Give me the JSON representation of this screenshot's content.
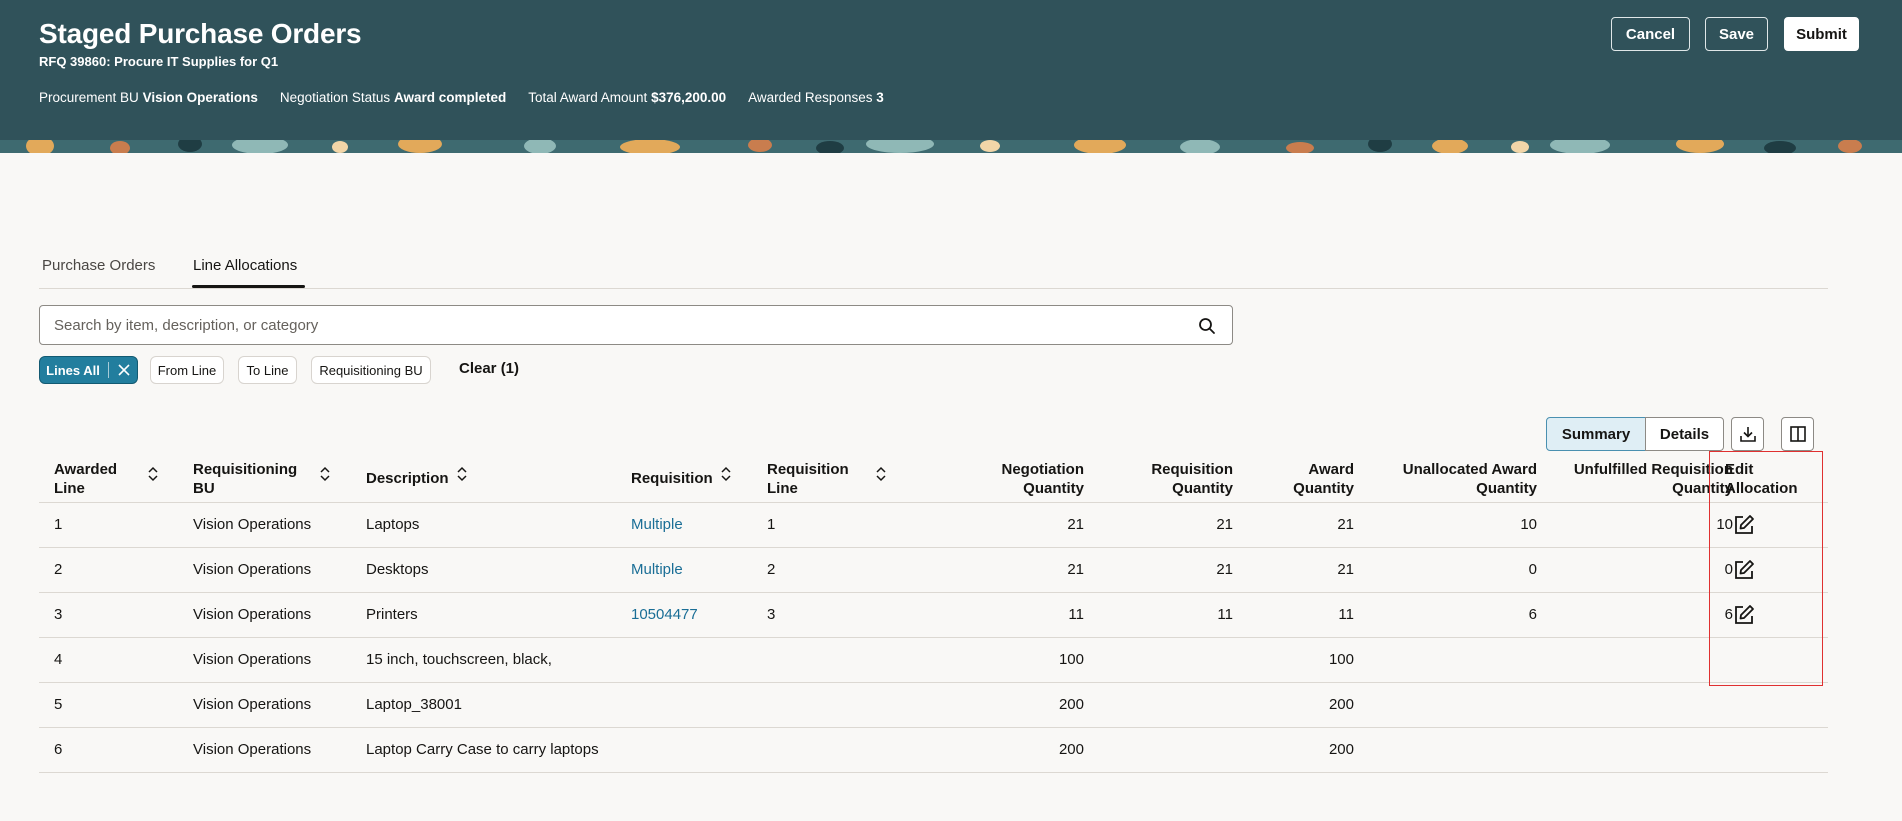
{
  "header": {
    "title": "Staged Purchase Orders",
    "subtitle": "RFQ 39860: Procure IT Supplies for Q1",
    "meta": [
      {
        "label": "Procurement BU",
        "value": "Vision Operations"
      },
      {
        "label": "Negotiation Status",
        "value": "Award completed"
      },
      {
        "label": "Total Award Amount",
        "value": "$376,200.00"
      },
      {
        "label": "Awarded Responses",
        "value": "3"
      }
    ],
    "cancel_label": "Cancel",
    "save_label": "Save",
    "submit_label": "Submit"
  },
  "tabs": [
    {
      "label": "Purchase Orders",
      "active": false
    },
    {
      "label": "Line Allocations",
      "active": true
    }
  ],
  "search": {
    "placeholder": "Search by item, description, or category",
    "value": ""
  },
  "filters": {
    "chips": [
      {
        "label": "Lines All",
        "active": true
      },
      {
        "label": "From Line",
        "active": false
      },
      {
        "label": "To Line",
        "active": false
      },
      {
        "label": "Requisitioning BU",
        "active": false
      }
    ],
    "clear_label": "Clear (1)"
  },
  "view_toggle": {
    "summary": "Summary",
    "details": "Details",
    "selected": "Summary"
  },
  "table": {
    "columns": [
      {
        "line1": "Awarded",
        "line2": "Line",
        "sortable": true
      },
      {
        "line1": "Requisitioning",
        "line2": "BU",
        "sortable": true
      },
      {
        "line1": "Description",
        "line2": "",
        "sortable": true
      },
      {
        "line1": "Requisition",
        "line2": "",
        "sortable": true
      },
      {
        "line1": "Requisition",
        "line2": "Line",
        "sortable": true
      },
      {
        "line1": "Negotiation",
        "line2": "Quantity",
        "sortable": false
      },
      {
        "line1": "Requisition",
        "line2": "Quantity",
        "sortable": false
      },
      {
        "line1": "Award",
        "line2": "Quantity",
        "sortable": false
      },
      {
        "line1": "Unallocated Award",
        "line2": "Quantity",
        "sortable": false
      },
      {
        "line1": "Unfulfilled Requisition",
        "line2": "Quantity",
        "sortable": false
      },
      {
        "line1": "Edit",
        "line2": "Allocation",
        "sortable": false
      }
    ],
    "rows": [
      {
        "awarded_line": "1",
        "bu": "Vision Operations",
        "description": "Laptops",
        "requisition": "Multiple",
        "req_line": "1",
        "neg_qty": "21",
        "req_qty": "21",
        "award_qty": "21",
        "unalloc_qty": "10",
        "unfulfilled_qty": "10",
        "editable": true
      },
      {
        "awarded_line": "2",
        "bu": "Vision Operations",
        "description": "Desktops",
        "requisition": "Multiple",
        "req_line": "2",
        "neg_qty": "21",
        "req_qty": "21",
        "award_qty": "21",
        "unalloc_qty": "0",
        "unfulfilled_qty": "0",
        "editable": true
      },
      {
        "awarded_line": "3",
        "bu": "Vision Operations",
        "description": "Printers",
        "requisition": "10504477",
        "req_line": "3",
        "neg_qty": "11",
        "req_qty": "11",
        "award_qty": "11",
        "unalloc_qty": "6",
        "unfulfilled_qty": "6",
        "editable": true
      },
      {
        "awarded_line": "4",
        "bu": "Vision Operations",
        "description": "15 inch, touchscreen, black,",
        "requisition": "",
        "req_line": "",
        "neg_qty": "100",
        "req_qty": "",
        "award_qty": "100",
        "unalloc_qty": "",
        "unfulfilled_qty": "",
        "editable": false
      },
      {
        "awarded_line": "5",
        "bu": "Vision Operations",
        "description": "Laptop_38001",
        "requisition": "",
        "req_line": "",
        "neg_qty": "200",
        "req_qty": "",
        "award_qty": "200",
        "unalloc_qty": "",
        "unfulfilled_qty": "",
        "editable": false
      },
      {
        "awarded_line": "6",
        "bu": "Vision Operations",
        "description": "Laptop Carry Case to carry laptops",
        "requisition": "",
        "req_line": "",
        "neg_qty": "200",
        "req_qty": "",
        "award_qty": "200",
        "unalloc_qty": "",
        "unfulfilled_qty": "",
        "editable": false
      }
    ]
  },
  "colors": {
    "header_bg": "#30525a",
    "accent": "#227e9e",
    "link": "#1a6e96",
    "highlight": "#e03030"
  }
}
